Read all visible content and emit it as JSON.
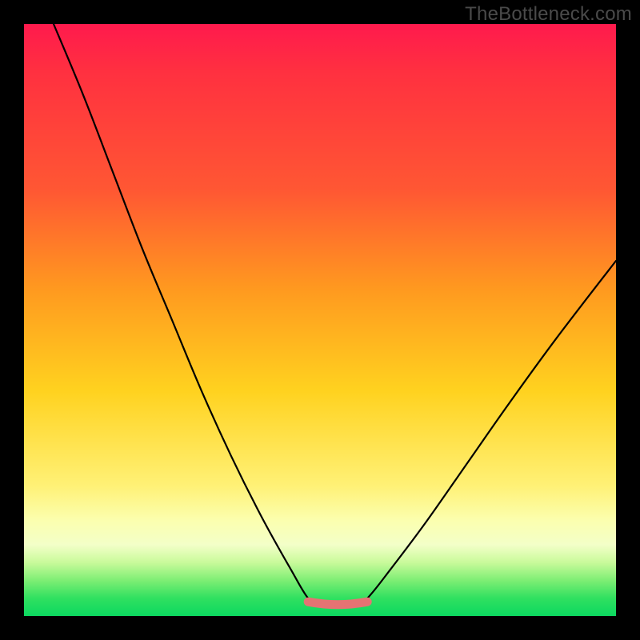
{
  "watermark": "TheBottleneck.com",
  "colors": {
    "frame": "#000000",
    "curve": "#000000",
    "bottom_segment": "#e57373",
    "gradient_top": "#ff1a4d",
    "gradient_bottom": "#0cd860"
  },
  "chart_data": {
    "type": "line",
    "title": "",
    "xlabel": "",
    "ylabel": "",
    "xlim": [
      0,
      100
    ],
    "ylim": [
      0,
      100
    ],
    "grid": false,
    "note": "V-shaped bottleneck curve over a red→green vertical gradient. Y increases upward (higher = worse / more bottleneck, red). Flat minimum near x≈48–58 at y≈2 (green zone). No axis ticks or numeric labels are shown.",
    "series": [
      {
        "name": "bottleneck-curve",
        "x": [
          5,
          10,
          15,
          20,
          25,
          30,
          35,
          40,
          45,
          48,
          50,
          53,
          56,
          58,
          62,
          68,
          75,
          82,
          90,
          100
        ],
        "y": [
          100,
          88,
          75,
          62,
          50,
          38,
          27,
          17,
          8,
          3,
          2,
          2,
          2,
          3,
          8,
          16,
          26,
          36,
          47,
          60
        ]
      }
    ],
    "flat_segment": {
      "x_start": 48,
      "x_end": 58,
      "y": 2,
      "color": "#e57373"
    }
  }
}
